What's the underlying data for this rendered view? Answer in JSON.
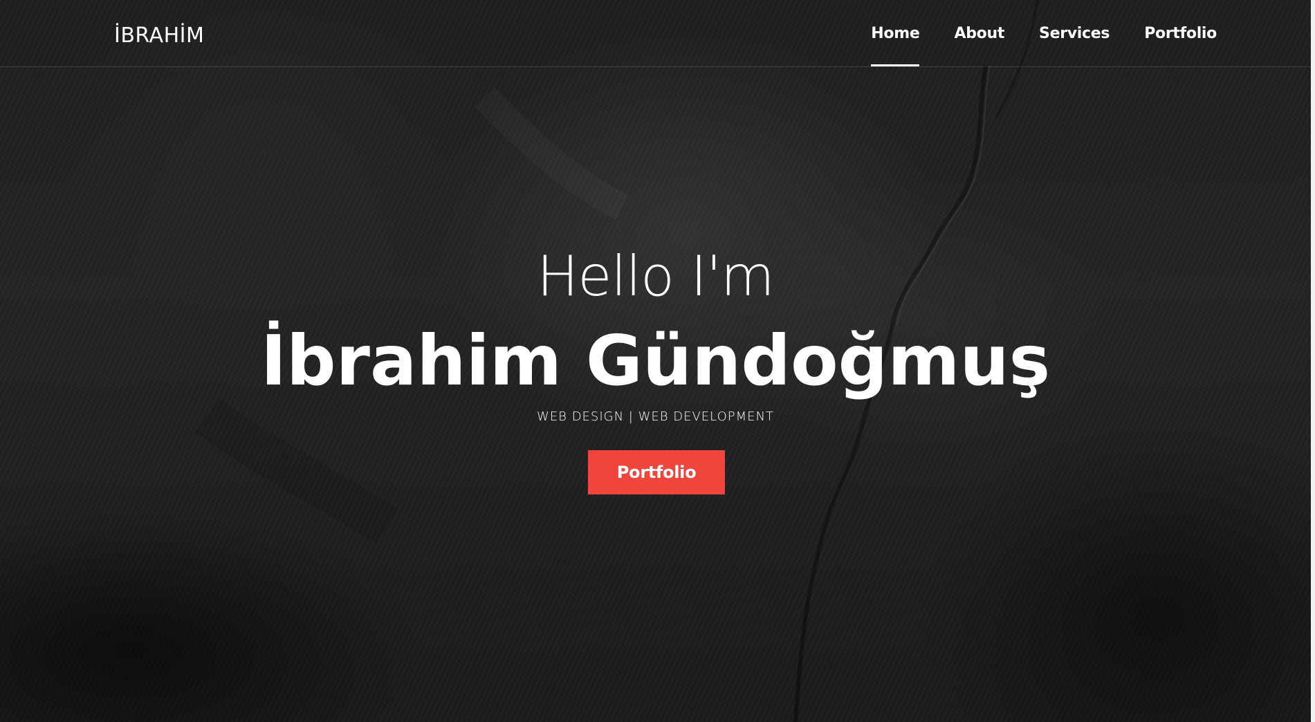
{
  "header": {
    "brand": "İBRAHİM",
    "nav": [
      {
        "label": "Home",
        "active": true
      },
      {
        "label": "About",
        "active": false
      },
      {
        "label": "Services",
        "active": false
      },
      {
        "label": "Portfolio",
        "active": false
      }
    ]
  },
  "hero": {
    "greeting": "Hello I'm",
    "name": "İbrahim Gündoğmuş",
    "tagline": "WEB DESIGN | WEB DEVELOPMENT",
    "cta_label": "Portfolio"
  },
  "colors": {
    "accent": "#f0453d",
    "text": "#ffffff",
    "background": "#1e1e1e"
  }
}
